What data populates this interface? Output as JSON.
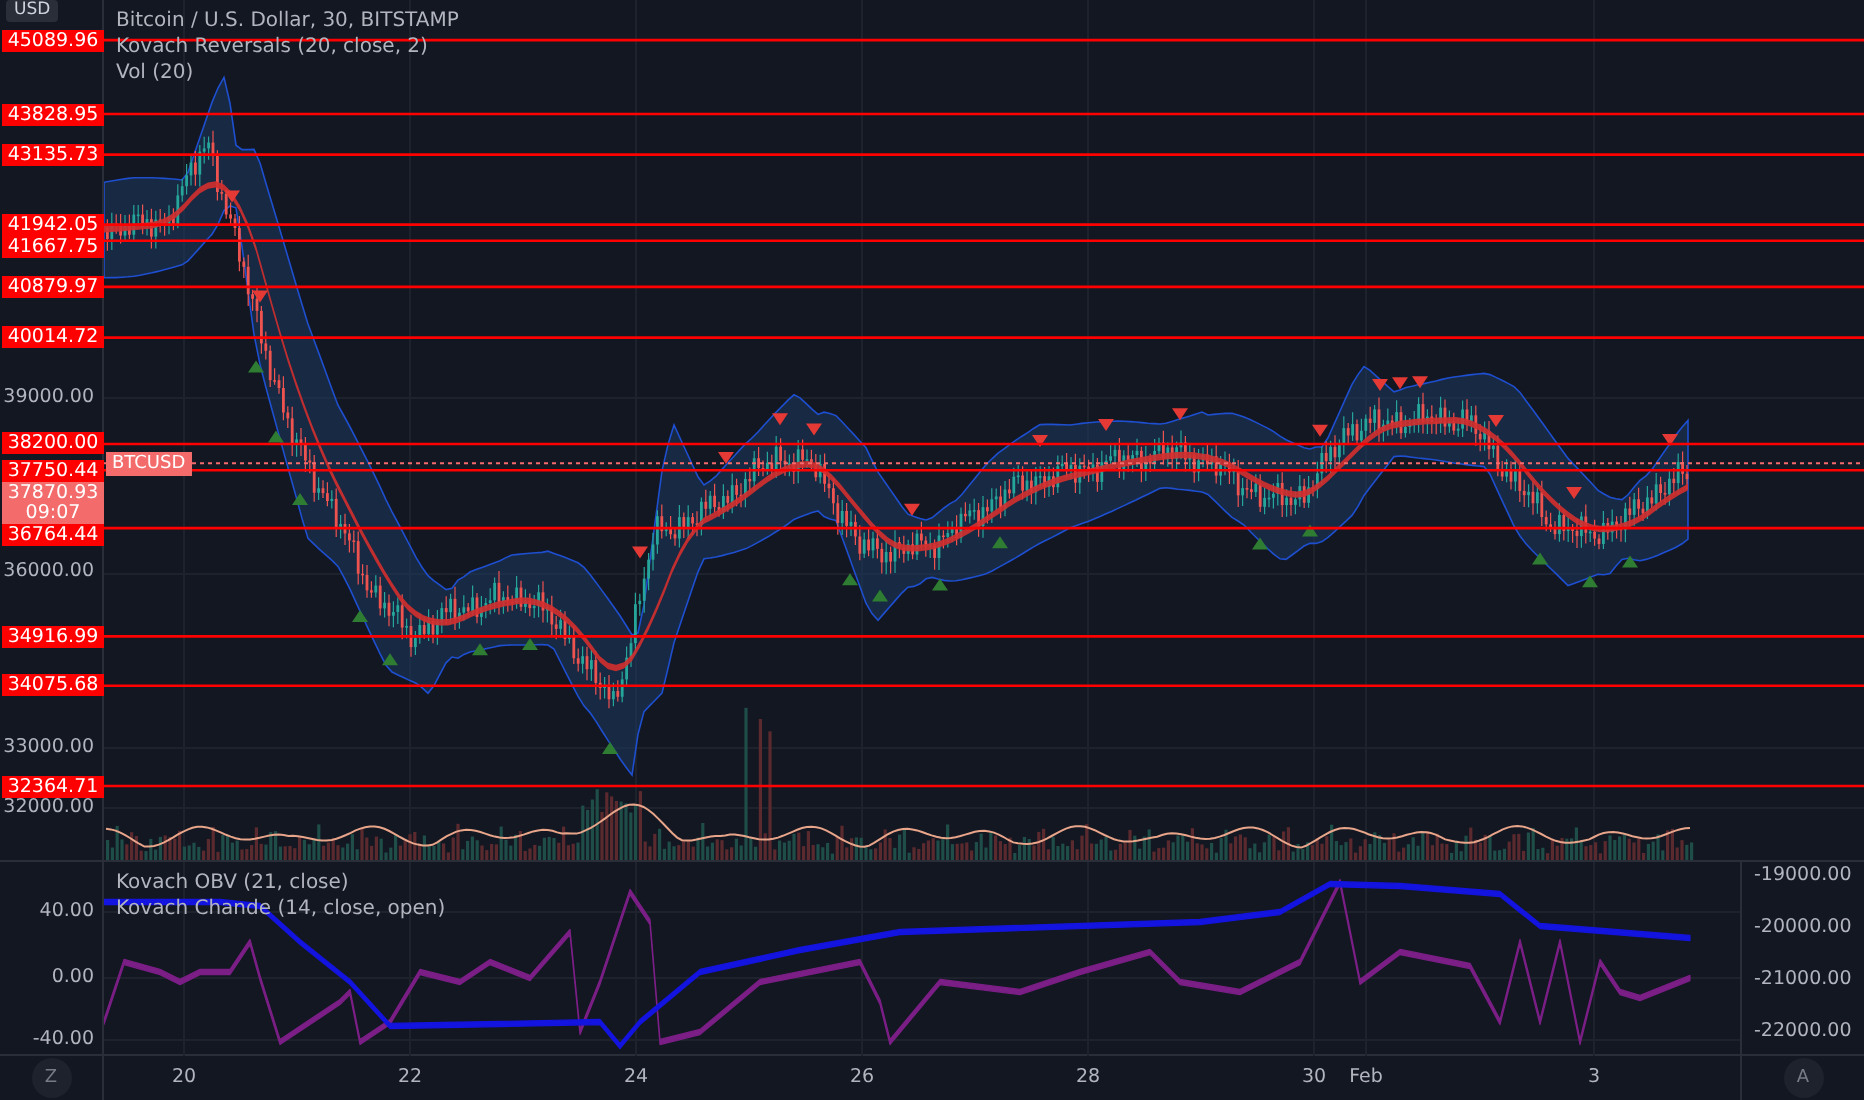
{
  "legend": {
    "title": "Bitcoin / U.S. Dollar, 30, BITSTAMP",
    "indicators": [
      "Kovach Reversals (20, close, 2)",
      "Vol (20)"
    ]
  },
  "price_axis": {
    "currency": "USD",
    "ticks": [
      "39000.00",
      "36000.00",
      "33000.00",
      "32000.00"
    ]
  },
  "levels": [
    "45089.96",
    "43828.95",
    "43135.73",
    "41942.05",
    "41667.75",
    "40879.97",
    "40014.72",
    "38200.00",
    "37750.44",
    "36764.44",
    "34916.99",
    "34075.68",
    "32364.71"
  ],
  "last_price": {
    "price": "37870.93",
    "countdown": "09:07",
    "symbol": "BTCUSD"
  },
  "lower_pane": {
    "indicators": [
      "Kovach OBV (21, close)",
      "Kovach Chande (14, close, open)"
    ],
    "left_ticks": [
      "40.00",
      "0.00",
      "-40.00"
    ],
    "right_ticks": [
      "-19000.00",
      "-20000.00",
      "-21000.00",
      "-22000.00"
    ]
  },
  "time_axis": {
    "labels": [
      "20",
      "22",
      "24",
      "26",
      "28",
      "30",
      "Feb",
      "3"
    ]
  },
  "buttons": [
    {
      "label": "Z"
    },
    {
      "label": "A"
    }
  ]
}
